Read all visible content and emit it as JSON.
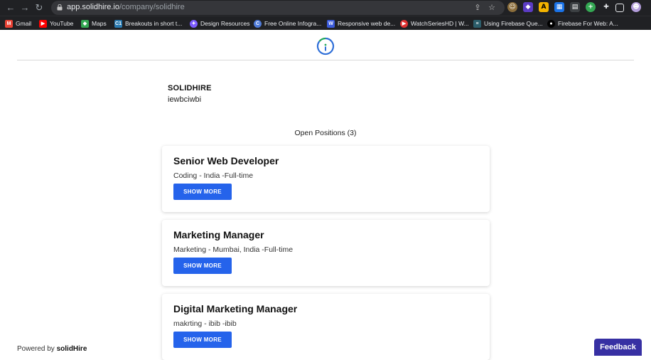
{
  "browser": {
    "url_host": "app.solidhire.io",
    "url_path": "/company/solidhire",
    "bookmarks": [
      {
        "label": "Gmail",
        "icon": "gmail-icon",
        "color": "#ea4335",
        "glyph": "M"
      },
      {
        "label": "YouTube",
        "icon": "youtube-icon",
        "color": "#ff0000",
        "glyph": "▶"
      },
      {
        "label": "Maps",
        "icon": "maps-icon",
        "color": "#34a853",
        "glyph": "◆"
      },
      {
        "label": "Breakouts in short t...",
        "icon": "c1-icon",
        "color": "#2a7ab0",
        "glyph": "C1"
      },
      {
        "label": "Design Resources",
        "icon": "design-resources-icon",
        "color": "#7c5cff",
        "glyph": "✦"
      },
      {
        "label": "Free Online Infogra...",
        "icon": "infographic-icon",
        "color": "#4f7bd9",
        "glyph": "C"
      },
      {
        "label": "Responsive web de...",
        "icon": "w-icon",
        "color": "#3b5bdb",
        "glyph": "W"
      },
      {
        "label": "WatchSeriesHD | W...",
        "icon": "watchseries-icon",
        "color": "#e03131",
        "glyph": "▶"
      },
      {
        "label": "Using Firebase Que...",
        "icon": "stackoverflow-icon",
        "color": "#2c5d6b",
        "glyph": "≡"
      },
      {
        "label": "Firebase For Web: A...",
        "icon": "medium-icon",
        "color": "#000000",
        "glyph": "●●"
      }
    ]
  },
  "company": {
    "name": "SOLIDHIRE",
    "description": "iewbciwbi"
  },
  "positions": {
    "heading": "Open Positions (3)",
    "button_label": "SHOW MORE",
    "items": [
      {
        "title": "Senior Web Developer",
        "meta": "Coding - India -Full-time"
      },
      {
        "title": "Marketing Manager",
        "meta": "Marketing - Mumbai, India -Full-time"
      },
      {
        "title": "Digital Marketing Manager",
        "meta": "makrting - ibib -ibib"
      }
    ]
  },
  "footer": {
    "powered_prefix": "Powered by",
    "powered_brand": "solidHire"
  },
  "feedback_label": "Feedback",
  "colors": {
    "primary_button": "#2563eb",
    "feedback": "#3730a3",
    "logo_blue": "#2f6fd8",
    "logo_green": "#22a85a"
  }
}
